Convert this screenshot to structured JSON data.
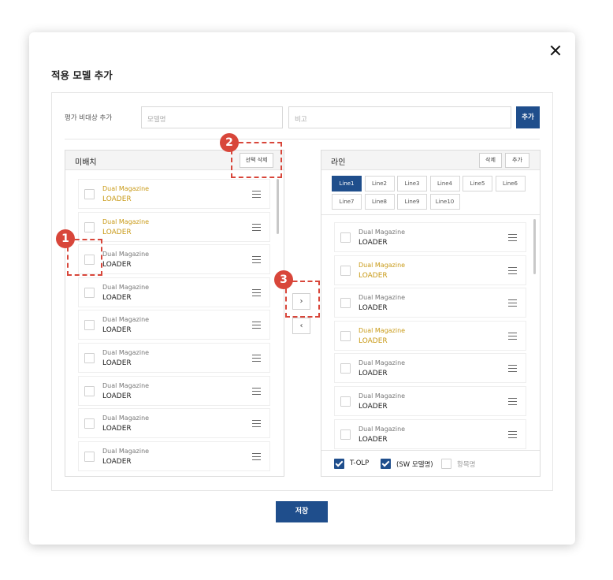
{
  "modal": {
    "title": "적용 모델 추가",
    "save_label": "저장"
  },
  "top_row": {
    "label": "평가 비대상 추가",
    "model_input": {
      "placeholder": "모델명",
      "value": ""
    },
    "note_input": {
      "placeholder": "비고",
      "value": ""
    },
    "add_label": "추가"
  },
  "unassigned": {
    "title": "미배치",
    "delete_selected_label": "선택 삭제",
    "items": [
      {
        "line1": "Dual Magazine",
        "line2": "LOADER",
        "highlight": true
      },
      {
        "line1": "Dual Magazine",
        "line2": "LOADER",
        "highlight": true
      },
      {
        "line1": "Dual Magazine",
        "line2": "LOADER",
        "highlight": false
      },
      {
        "line1": "Dual Magazine",
        "line2": "LOADER",
        "highlight": false
      },
      {
        "line1": "Dual Magazine",
        "line2": "LOADER",
        "highlight": false
      },
      {
        "line1": "Dual Magazine",
        "line2": "LOADER",
        "highlight": false
      },
      {
        "line1": "Dual Magazine",
        "line2": "LOADER",
        "highlight": false
      },
      {
        "line1": "Dual Magazine",
        "line2": "LOADER",
        "highlight": false
      },
      {
        "line1": "Dual Magazine",
        "line2": "LOADER",
        "highlight": false
      }
    ]
  },
  "move": {
    "right": "›",
    "left": "‹"
  },
  "line_panel": {
    "title": "라인",
    "delete_label": "삭제",
    "add_label": "추가",
    "tabs": [
      "Line1",
      "Line2",
      "Line3",
      "Line4",
      "Line5",
      "Line6",
      "Line7",
      "Line8",
      "Line9",
      "Line10"
    ],
    "active_tab": "Line1",
    "items": [
      {
        "line1": "Dual Magazine",
        "line2": "LOADER",
        "highlight": false
      },
      {
        "line1": "Dual Magazine",
        "line2": "LOADER",
        "highlight": true
      },
      {
        "line1": "Dual Magazine",
        "line2": "LOADER",
        "highlight": false
      },
      {
        "line1": "Dual Magazine",
        "line2": "LOADER",
        "highlight": true
      },
      {
        "line1": "Dual Magazine",
        "line2": "LOADER",
        "highlight": false
      },
      {
        "line1": "Dual Magazine",
        "line2": "LOADER",
        "highlight": false
      },
      {
        "line1": "Dual Magazine",
        "line2": "LOADER",
        "highlight": false
      }
    ],
    "footer": [
      {
        "label": "T-OLP",
        "checked": true
      },
      {
        "label": "(SW 모델명)",
        "checked": true
      },
      {
        "label": "항목명",
        "checked": false
      }
    ]
  },
  "annotations": [
    "1",
    "2",
    "3"
  ],
  "colors": {
    "primary": "#1f4e8c",
    "highlight_text": "#c99a17",
    "annotation": "#d8463a"
  },
  "icons": {
    "close": "close-icon",
    "drag": "drag-handle-icon",
    "move_right": "chevron-right-icon",
    "move_left": "chevron-left-icon"
  }
}
